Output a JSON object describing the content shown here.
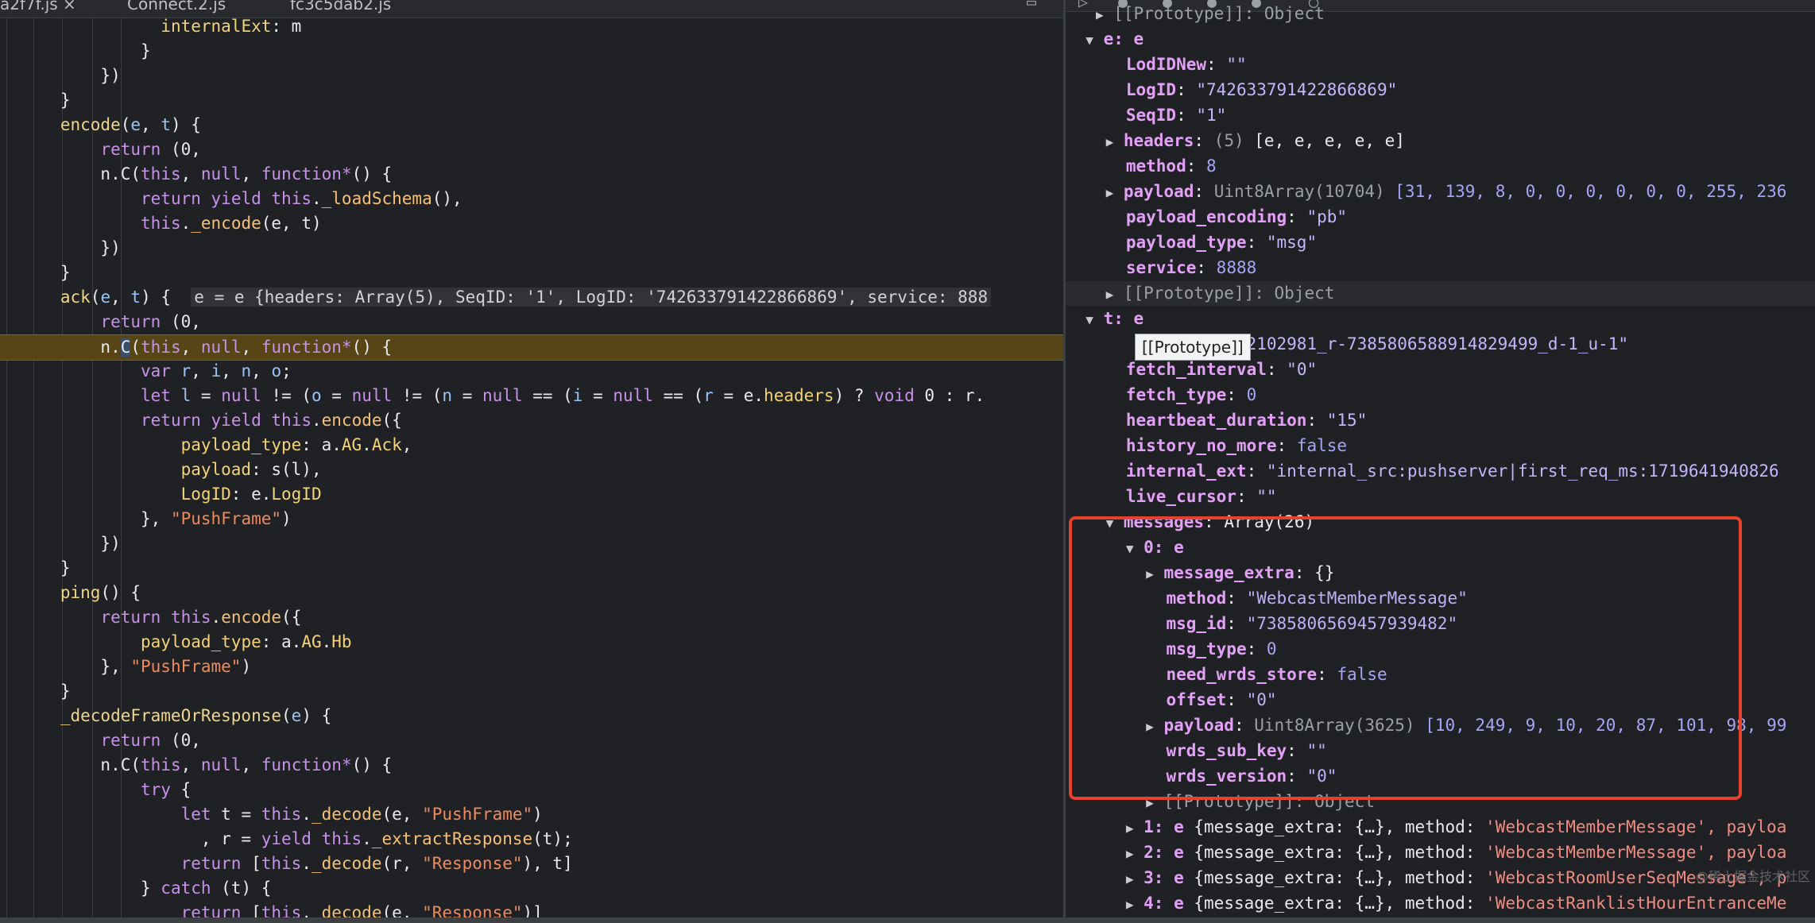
{
  "tabs": [
    {
      "label": "a2f7f.js ×",
      "active": true
    },
    {
      "label": "Connect.2.js",
      "active": false
    },
    {
      "label": "fc3c5dab2.js",
      "active": false
    }
  ],
  "code": {
    "internalExt": "internalExt",
    "encode": "encode",
    "return": "return",
    "this": "this",
    "null": "null",
    "function_star": "function*",
    "yield": "yield",
    "loadSchema": "_loadSchema",
    "encode_priv": "_encode",
    "ack": "ack",
    "inline_value": "e = e {headers: Array(5), SeqID: '1', LogID: '742633791422866869', service: 888",
    "var": "var",
    "let": "let",
    "void": "void",
    "headers": "headers",
    "payload_type": "payload_type",
    "AG": "AG",
    "Ack": "Ack",
    "payload": "payload",
    "LogID": "LogID",
    "PushFrame": "\"PushFrame\"",
    "ping": "ping",
    "Hb": "Hb",
    "decodeFrameOrResponse": "_decodeFrameOrResponse",
    "try": "try",
    "decode": "_decode",
    "extractResponse": "_extractResponse",
    "Response": "\"Response\"",
    "catch": "catch"
  },
  "scope": {
    "prototype_top": "[[Prototype]]: Object",
    "e_label": "e: e",
    "LodIDNew": {
      "key": "LodIDNew",
      "value": "\"\""
    },
    "LogID": {
      "key": "LogID",
      "value": "\"742633791422866869\""
    },
    "SeqID": {
      "key": "SeqID",
      "value": "\"1\""
    },
    "headers": {
      "key": "headers",
      "count": "(5)",
      "value": "[e, e, e, e, e]"
    },
    "method": {
      "key": "method",
      "value": "8"
    },
    "payload": {
      "key": "payload",
      "type": "Uint8Array(10704)",
      "value": "[31, 139, 8, 0, 0, 0, 0, 0, 0, 255, 236"
    },
    "payload_encoding": {
      "key": "payload_encoding",
      "value": "\"pb\""
    },
    "payload_type": {
      "key": "payload_type",
      "value": "\"msg\""
    },
    "service": {
      "key": "service",
      "value": "8888"
    },
    "prototype": "[[Prototype]]: Object",
    "t_label": "t: e",
    "cursor_tail": "719642102981_r-7385806588914829499_d-1_u-1\"",
    "fetch_interval": {
      "key": "fetch_interval",
      "value": "\"0\""
    },
    "fetch_type": {
      "key": "fetch_type",
      "value": "0"
    },
    "heartbeat_duration": {
      "key": "heartbeat_duration",
      "value": "\"15\""
    },
    "history_no_more": {
      "key": "history_no_more",
      "value": "false"
    },
    "internal_ext": {
      "key": "internal_ext",
      "value": "\"internal_src:pushserver|first_req_ms:1719641940826"
    },
    "live_cursor": {
      "key": "live_cursor",
      "value": "\"\""
    },
    "messages": {
      "key": "messages",
      "value": "Array(26)"
    },
    "msg0_label": "0: e",
    "message_extra": {
      "key": "message_extra",
      "value": "{}"
    },
    "msg_method": {
      "key": "method",
      "value": "\"WebcastMemberMessage\""
    },
    "msg_id": {
      "key": "msg_id",
      "value": "\"7385806569457939482\""
    },
    "msg_type": {
      "key": "msg_type",
      "value": "0"
    },
    "need_wrds_store": {
      "key": "need_wrds_store",
      "value": "false"
    },
    "offset": {
      "key": "offset",
      "value": "\"0\""
    },
    "msg_payload": {
      "key": "payload",
      "type": "Uint8Array(3625)",
      "value": "[10, 249, 9, 10, 20, 87, 101, 98, 99"
    },
    "wrds_sub_key": {
      "key": "wrds_sub_key",
      "value": "\"\""
    },
    "wrds_version": {
      "key": "wrds_version",
      "value": "\"0\""
    },
    "msg0_prototype": "[[Prototype]]: Object",
    "collapsed_messages": [
      {
        "index": "1: e",
        "summary": "{message_extra: {…}, method: ",
        "method": "'WebcastMemberMessage', payloa"
      },
      {
        "index": "2: e",
        "summary": "{message_extra: {…}, method: ",
        "method": "'WebcastMemberMessage', payloa"
      },
      {
        "index": "3: e",
        "summary": "{message_extra: {…}, method: ",
        "method": "'WebcastRoomUserSeqMessage', p"
      },
      {
        "index": "4: e",
        "summary": "{message_extra: {…}, method: ",
        "method": "'WebcastRanklistHourEntranceMe"
      }
    ]
  },
  "tooltip": "[[Prototype]]",
  "watermark": "@稀土掘金技术社区",
  "colors": {
    "highlight_border": "#e5412d",
    "exec_line": "#574515"
  }
}
